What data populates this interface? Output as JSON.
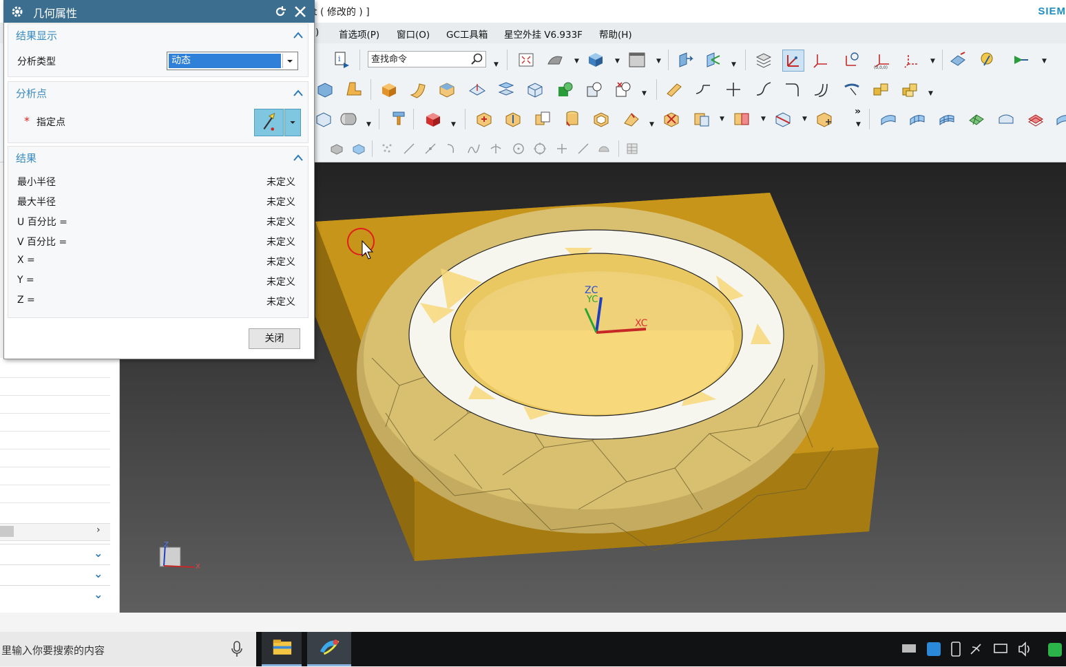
{
  "window": {
    "title": "t ( 修改的 ) ]",
    "brand": "SIEM"
  },
  "menubar": {
    "items": [
      ")",
      "首选项(P)",
      "窗口(O)",
      "GC工具箱",
      "星空外挂 V6.933F",
      "帮助(H)"
    ]
  },
  "toolbar": {
    "search_placeholder": "查找命令",
    "more_label": "»"
  },
  "dialog": {
    "title": "几何属性",
    "sections": {
      "display": {
        "title": "结果显示",
        "analysis_type_label": "分析类型",
        "analysis_type_value": "动态"
      },
      "point": {
        "title": "分析点",
        "required_mark": "*",
        "specify_point_label": "指定点"
      },
      "results": {
        "title": "结果",
        "rows": [
          {
            "label": "最小半径",
            "value": "未定义"
          },
          {
            "label": "最大半径",
            "value": "未定义"
          },
          {
            "label": "U 百分比 =",
            "value": "未定义"
          },
          {
            "label": "V 百分比 =",
            "value": "未定义"
          },
          {
            "label": "X =",
            "value": "未定义"
          },
          {
            "label": "Y =",
            "value": "未定义"
          },
          {
            "label": "Z =",
            "value": "未定义"
          }
        ]
      }
    },
    "close_button": "关闭"
  },
  "viewport": {
    "axis_labels": {
      "zc": "ZC",
      "yc": "YC",
      "xc": "XC"
    },
    "triad_labels": {
      "z": "Z",
      "x": "X"
    },
    "colors": {
      "part_gold": "#c7951a",
      "face_light": "#f6f6ee",
      "inner_yellow": "#f7d87a",
      "background_top": "#232323",
      "background_bottom": "#5e5e5e"
    }
  },
  "taskbar": {
    "search_text": "里输入你要搜索的内容"
  },
  "colors": {
    "dialog_header": "#3c6e8f",
    "section_title": "#3a8bbf",
    "selected_value": "#2f80d8",
    "required_star": "#d9221c"
  }
}
